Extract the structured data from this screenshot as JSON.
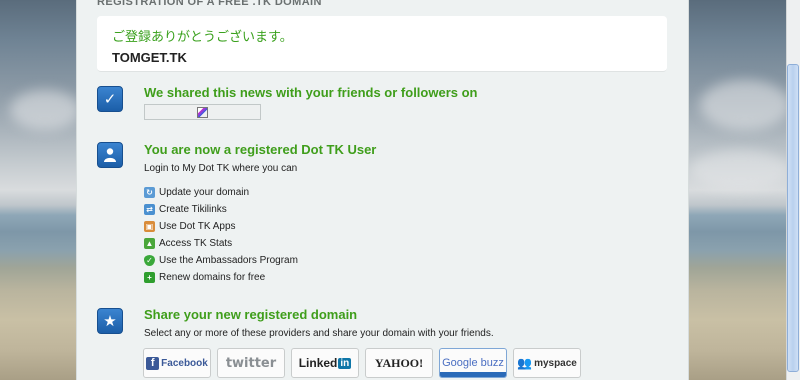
{
  "header": {
    "registration_title": "REGISTRATION OF A FREE .TK DOMAIN"
  },
  "confirmation": {
    "thanks_jp": "ご登録ありがとうございます。",
    "domain": "TOMGET.TK"
  },
  "sections": {
    "shared": {
      "title": "We shared this news with your friends or followers on",
      "icon": "checkmark-icon"
    },
    "registered": {
      "title": "You are now a registered Dot TK User",
      "subtitle": "Login to My Dot TK where you can",
      "icon": "user-icon",
      "features": [
        {
          "label": "Update your domain",
          "icon": "update-icon",
          "color": "#5b9bd5"
        },
        {
          "label": "Create Tikilinks",
          "icon": "link-icon",
          "color": "#4a90d0"
        },
        {
          "label": "Use Dot TK Apps",
          "icon": "apps-icon",
          "color": "#d98c3a"
        },
        {
          "label": "Access TK Stats",
          "icon": "stats-icon",
          "color": "#4aa63a"
        },
        {
          "label": "Use the Ambassadors Program",
          "icon": "shield-icon",
          "color": "#3aa83a"
        },
        {
          "label": "Renew domains for free",
          "icon": "plus-icon",
          "color": "#2e9e2e"
        }
      ]
    },
    "share": {
      "title": "Share your new registered domain",
      "subtitle": "Select any or more of these providers and share your domain with your friends.",
      "icon": "star-icon",
      "providers": [
        "Facebook",
        "twitter",
        "Linked",
        "YAHOO!",
        "Google buzz",
        "myspace"
      ]
    }
  },
  "colors": {
    "accent_green": "#3f9e1b",
    "icon_blue": "#1b5ea8"
  }
}
